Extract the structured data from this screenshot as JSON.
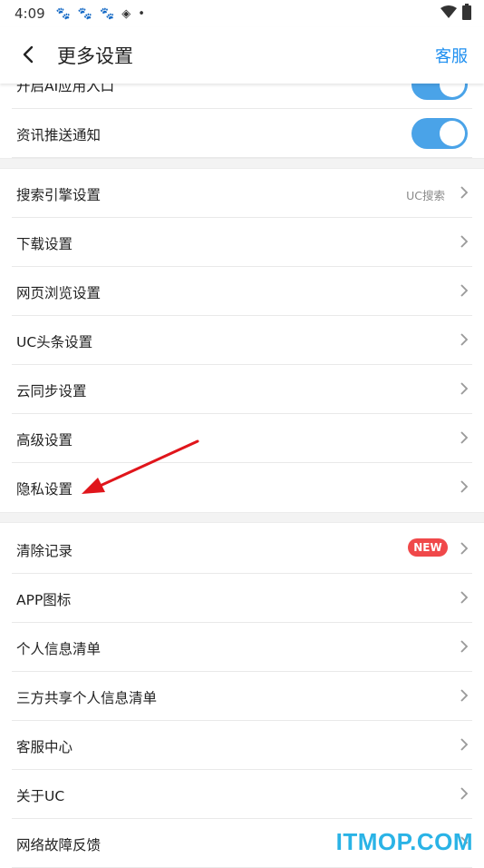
{
  "status_bar": {
    "time": "4:09"
  },
  "header": {
    "title": "更多设置",
    "service_label": "客服"
  },
  "group_top": [
    {
      "label": "开启AI应用入口",
      "toggle_on": true
    },
    {
      "label": "资讯推送通知",
      "toggle_on": true
    }
  ],
  "group_settings": [
    {
      "label": "搜索引擎设置",
      "value": "UC搜索"
    },
    {
      "label": "下载设置"
    },
    {
      "label": "网页浏览设置"
    },
    {
      "label": "UC头条设置"
    },
    {
      "label": "云同步设置"
    },
    {
      "label": "高级设置"
    },
    {
      "label": "隐私设置"
    }
  ],
  "group_misc": [
    {
      "label": "清除记录",
      "badge": "NEW"
    },
    {
      "label": "APP图标"
    },
    {
      "label": "个人信息清单"
    },
    {
      "label": "三方共享个人信息清单"
    },
    {
      "label": "客服中心"
    },
    {
      "label": "关于UC"
    },
    {
      "label": "网络故障反馈"
    }
  ],
  "watermark": "ITMOP.COM",
  "colors": {
    "accent": "#1e8ff0",
    "toggle": "#4aa3e8",
    "badge": "#f0484a",
    "arrow": "#e0151b"
  }
}
